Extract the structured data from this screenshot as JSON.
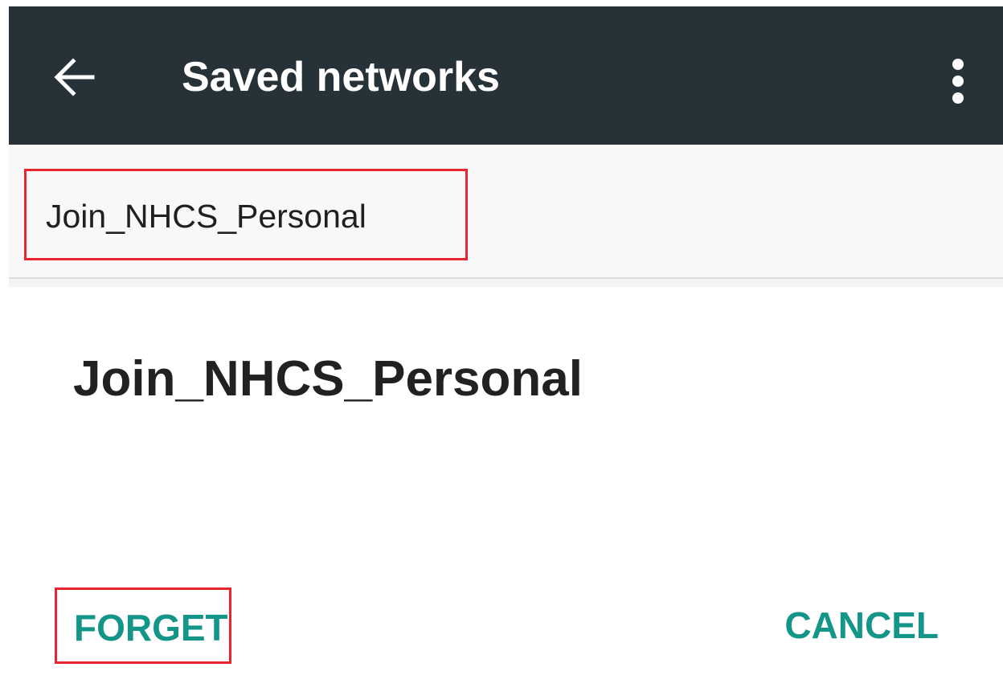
{
  "app_bar": {
    "title": "Saved networks",
    "back_icon": "arrow-left-icon",
    "overflow_icon": "more-vert-icon",
    "background_color": "#263238"
  },
  "saved_networks": {
    "items": [
      {
        "label": "Join_NHCS_Personal"
      }
    ]
  },
  "dialog": {
    "title": "Join_NHCS_Personal",
    "forget_label": "FORGET",
    "cancel_label": "CANCEL",
    "accent_color": "#139688"
  },
  "highlight_color": "#e8242f"
}
